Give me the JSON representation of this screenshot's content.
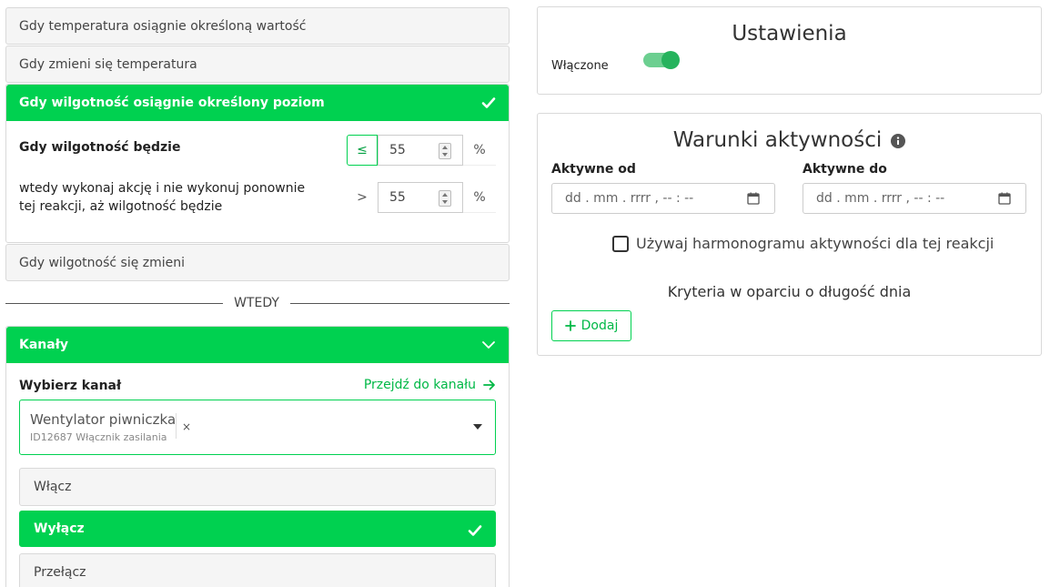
{
  "conditions": {
    "item1": "Gdy temperatura osiągnie określoną wartość",
    "item2": "Gdy zmieni się temperatura",
    "active": {
      "title": "Gdy wilgotność osiągnie określony poziom",
      "when_label": "Gdy wilgotność będzie",
      "when_operator": "≤",
      "when_value": "55",
      "then_label": "wtedy wykonaj akcję i nie wykonuj ponownie tej reakcji, aż wilgotność będzie",
      "then_operator": ">",
      "then_value": "55",
      "unit": "%"
    },
    "item4": "Gdy wilgotność się zmieni"
  },
  "divider_label": "WTEDY",
  "channels": {
    "title": "Kanały",
    "select_label": "Wybierz kanał",
    "goto_link": "Przejdź do kanału",
    "selected_name": "Wentylator piwniczka",
    "selected_sub": "ID12687 Włącznik zasilania",
    "clear": "×",
    "actions": [
      {
        "label": "Włącz",
        "selected": false
      },
      {
        "label": "Wyłącz",
        "selected": true
      },
      {
        "label": "Przełącz",
        "selected": false
      }
    ]
  },
  "settings": {
    "title": "Ustawienia",
    "enabled_label": "Włączone",
    "enabled": true
  },
  "activity": {
    "title": "Warunki aktywności",
    "from_label": "Aktywne od",
    "to_label": "Aktywne do",
    "from_placeholder": "dd . mm . rrrr ,  -- : --",
    "to_placeholder": "dd . mm . rrrr ,  -- : --",
    "schedule_label": "Używaj harmonogramu aktywności dla tej reakcji",
    "criteria_label": "Kryteria w oparciu o długość dnia",
    "add_label": "Dodaj"
  },
  "colors": {
    "accent": "#00d150",
    "toggle": "#26b35d"
  }
}
